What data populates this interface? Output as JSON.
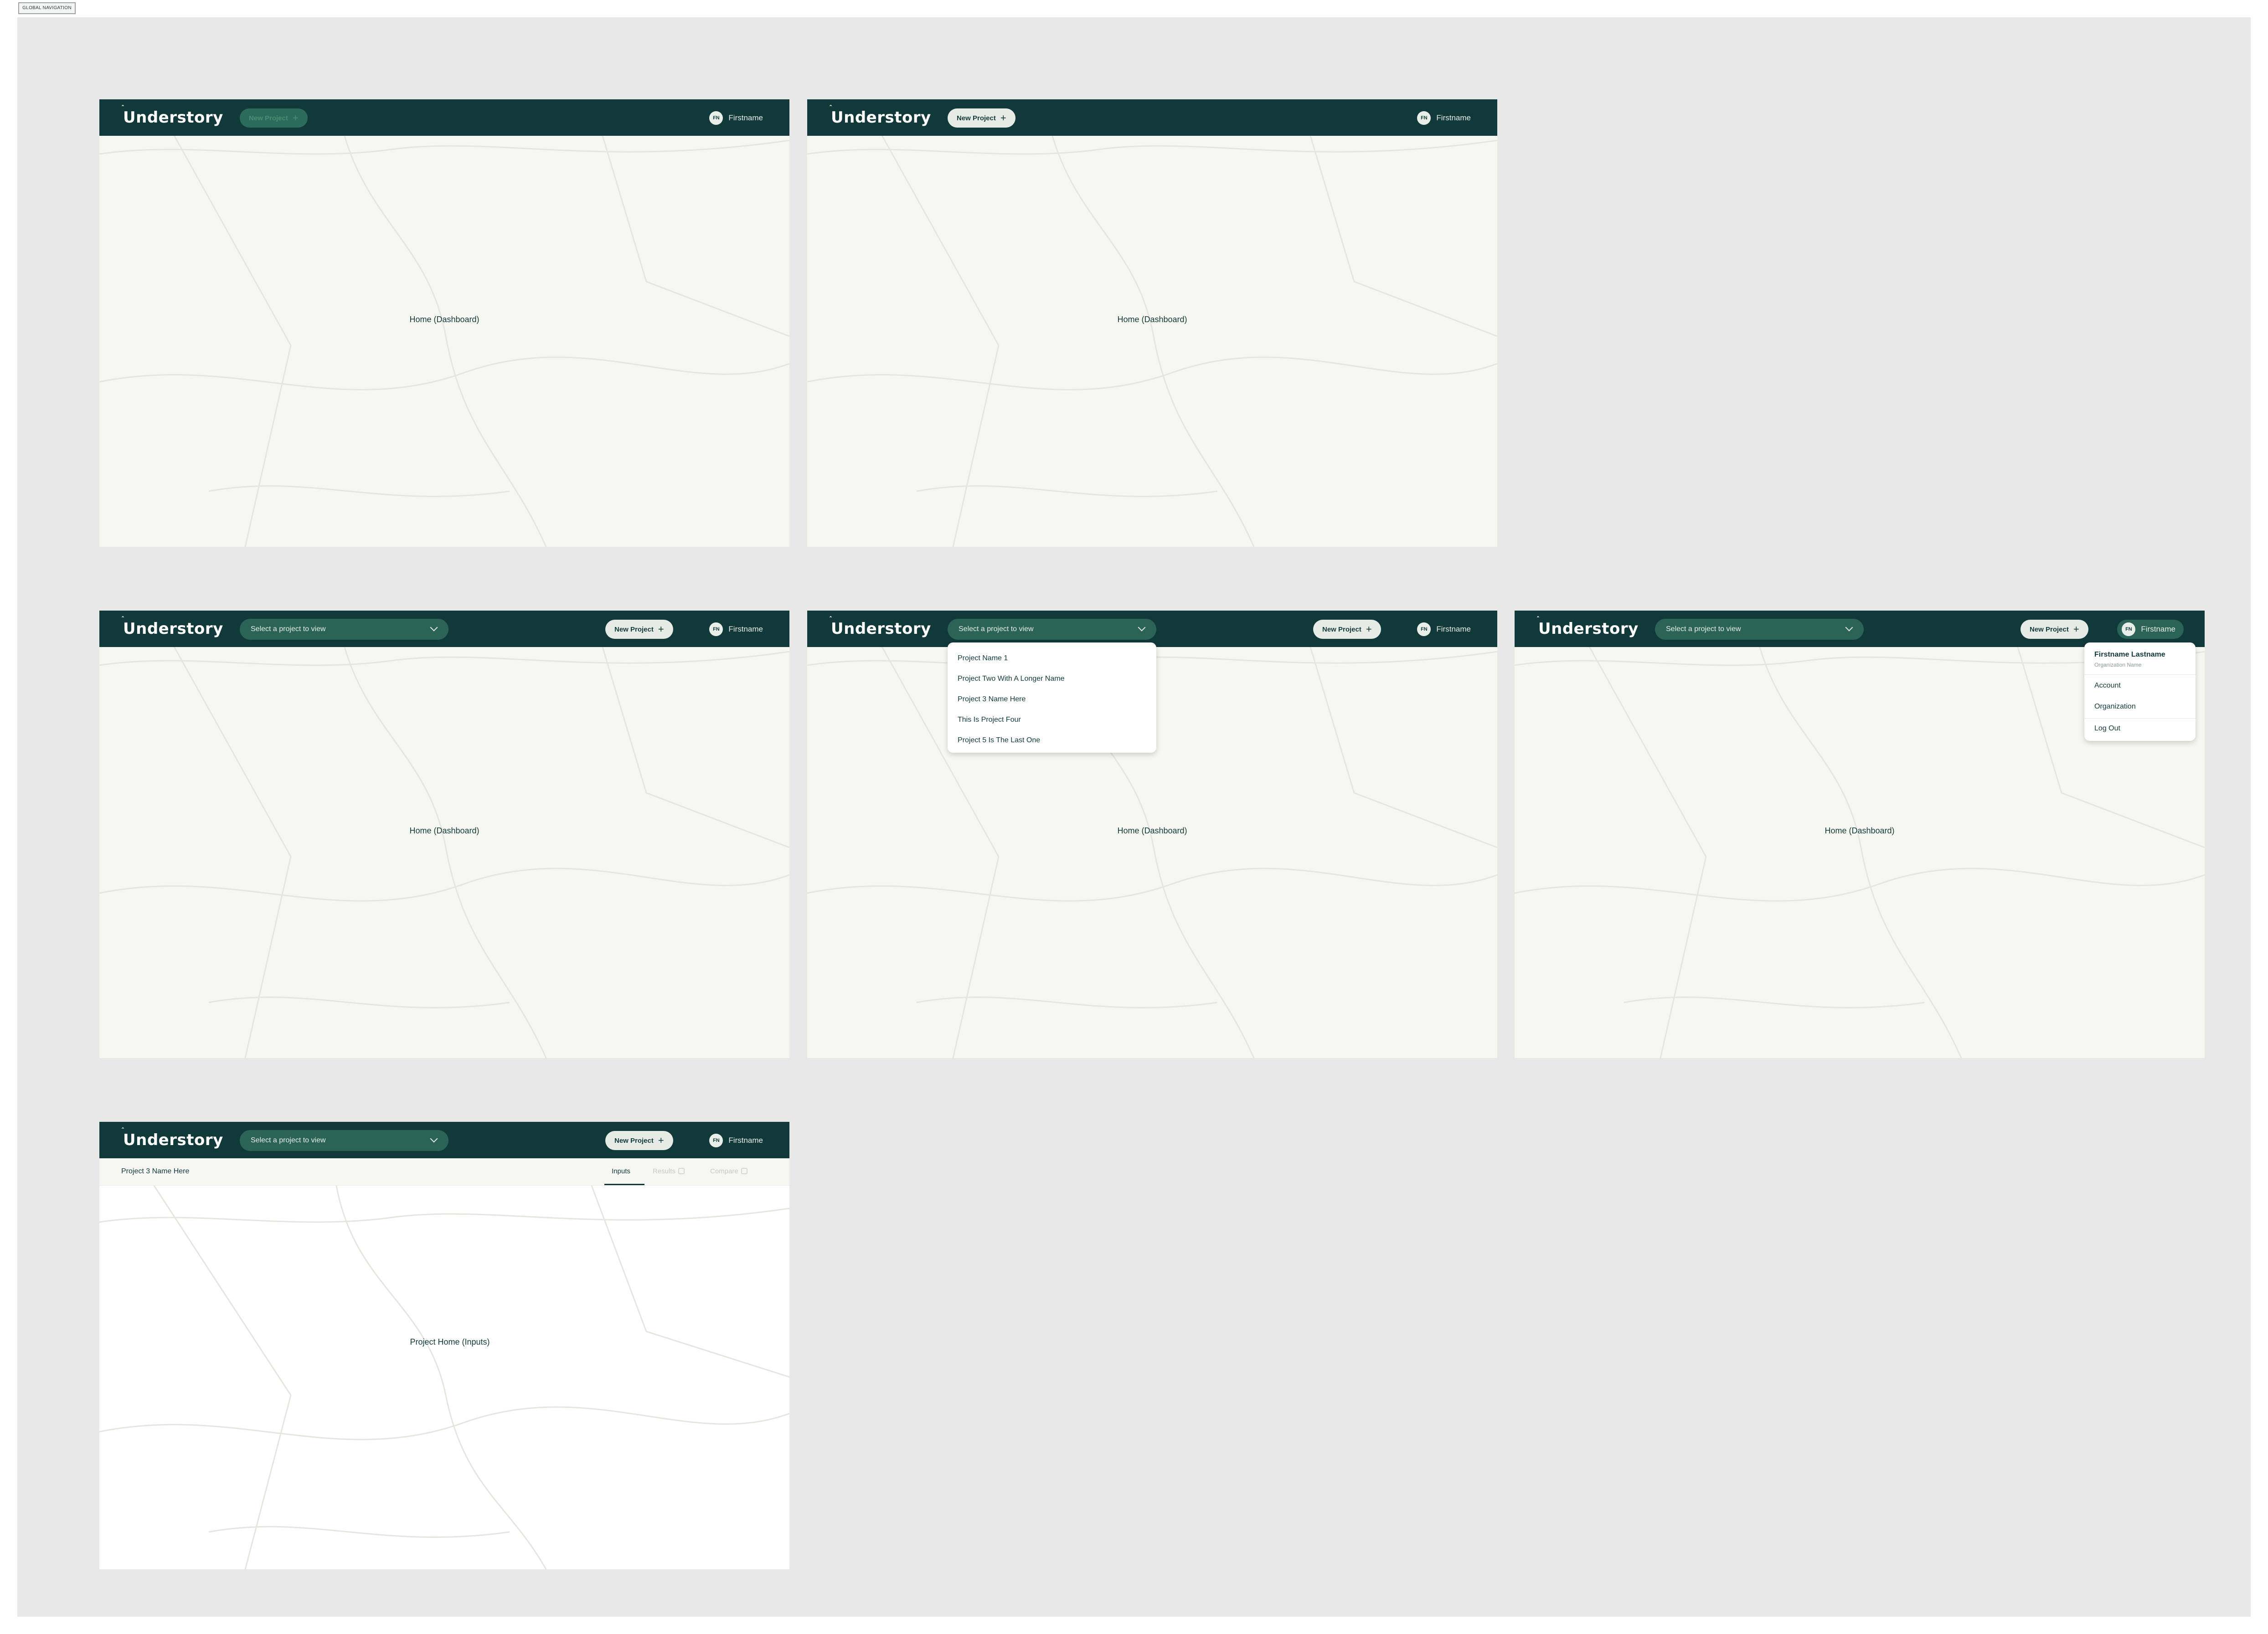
{
  "frame": {
    "label": "GLOBAL NAVIGATION"
  },
  "brand": {
    "name": "Understory",
    "sprout_glyph": "ˆ"
  },
  "colors": {
    "nav_bg": "#12393a",
    "canvas": "#e8e8e8",
    "screen_bg": "#f7f7f2",
    "accent": "#2b6356"
  },
  "nav": {
    "new_project": "New Project",
    "plus": "+",
    "select_placeholder": "Select a project to view",
    "user_initials": "FN",
    "user_firstname": "Firstname"
  },
  "screens": {
    "home_label": "Home (Dashboard)",
    "project_home_label": "Project Home (Inputs)"
  },
  "projects": [
    "Project Name 1",
    "Project Two With A Longer Name",
    "Project 3 Name Here",
    "This Is Project Four",
    "Project 5 Is The Last One"
  ],
  "user_menu": {
    "full_name": "Firstname Lastname",
    "organization_name": "Organization Name",
    "items": [
      "Account",
      "Organization",
      "Log Out"
    ]
  },
  "project_view": {
    "title": "Project 3 Name Here",
    "tabs": [
      "Inputs",
      "Results",
      "Compare"
    ]
  },
  "icons": {
    "chevron": "chevron-down-icon",
    "lock": "lock-icon",
    "plus": "plus-icon"
  }
}
